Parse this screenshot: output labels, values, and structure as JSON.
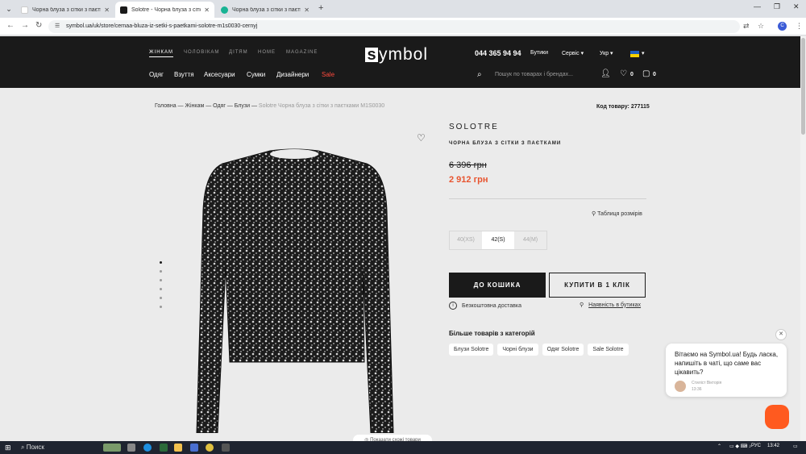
{
  "browser": {
    "tabs": [
      {
        "title": "Чорна блуза з сітки з паєтками",
        "active": false
      },
      {
        "title": "Solotre - Чорна блуза з сітки з",
        "active": true
      },
      {
        "title": "Чорна блуза з сітки з паєтками",
        "active": false
      }
    ],
    "url": "symbol.ua/uk/store/cernaa-bluza-iz-setki-s-paetkami-solotre-m1s0030-cernyj",
    "profile_initial": "C"
  },
  "header": {
    "top_nav": [
      "ЖІНКАМ",
      "ЧОЛОВІКАМ",
      "ДІТЯМ",
      "HOME",
      "MAGAZINE"
    ],
    "logo_letter": "s",
    "logo_rest": "ymbol",
    "phone": "044 365 94 94",
    "links": {
      "stores": "Бутики",
      "service": "Сервіс",
      "lang": "Укр"
    },
    "categories": [
      "Одяг",
      "Взуття",
      "Аксесуари",
      "Сумки",
      "Дизайнери",
      "Sale"
    ],
    "search_placeholder": "Пошук по товарах і брендах...",
    "wishlist_count": "0",
    "cart_count": "0"
  },
  "breadcrumb": {
    "path": "Головна — Жінкам — Одяг — Блузи — ",
    "current": "Solotre Чорна блуза з сітки з паєтками M1S0030"
  },
  "product": {
    "code_label": "Код товару: 277115",
    "brand": "SOLOTRE",
    "name": "ЧОРНА БЛУЗА З СІТКИ З ПАЄТКАМИ",
    "old_price": "6 396 грн",
    "new_price": "2 912 грн",
    "size_table": "Таблиця розмірів",
    "sizes": [
      {
        "label": "40(XS)",
        "selected": false
      },
      {
        "label": "42(S)",
        "selected": true
      },
      {
        "label": "44(M)",
        "selected": false
      }
    ],
    "add_to_cart": "ДО КОШИКА",
    "buy_one_click": "КУПИТИ В 1 КЛІК",
    "free_delivery": "Безкоштовна доставка",
    "availability": "Наявність в бутиках",
    "more_title": "Більше товарів з категорій",
    "chips": [
      "Блузи Solotre",
      "Чорні блузи",
      "Одяг Solotre",
      "Sale Solotre"
    ],
    "similar": "Показати схожі товари",
    "gallery_count": 6
  },
  "chat": {
    "message": "Вітаємо на Symbol.ua! Будь ласка, напишіть в чаті, що саме вас цікавить?",
    "agent": "Стиліст Вікторія",
    "time": "13:36"
  },
  "taskbar": {
    "search": "Поиск",
    "lang": "РУС",
    "time": "13:42"
  },
  "colors": {
    "header_bg": "#1a1a1a",
    "sale": "#ff4a3d",
    "price_accent": "#e8542f",
    "chat_fab": "#ff5a1f"
  }
}
